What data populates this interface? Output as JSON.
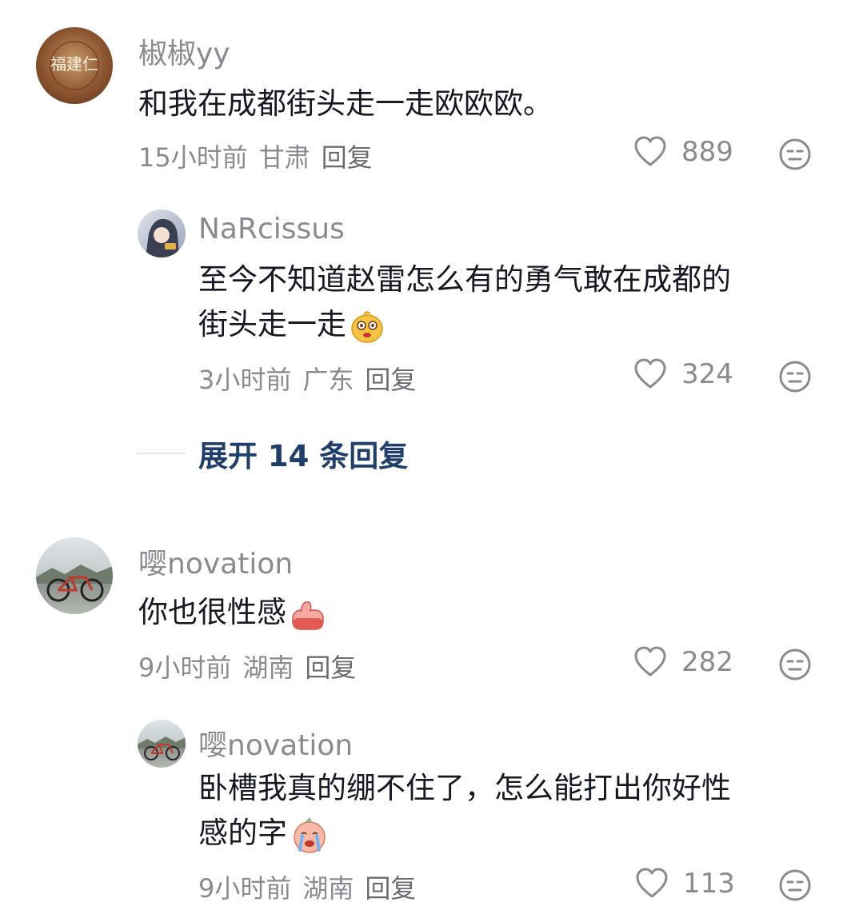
{
  "comments": [
    {
      "username": "椒椒yy",
      "text": "和我在成都街头走一走欧欧欧。",
      "time": "15小时前",
      "location": "甘肃",
      "reply_label": "回复",
      "likes": "889",
      "avatar_text": "福建仁"
    },
    {
      "username": "NaRcissus",
      "text_line1": "至今不知道赵雷怎么有的勇气敢在成都的",
      "text_line2": "街头走一走",
      "time": "3小时前",
      "location": "广东",
      "reply_label": "回复",
      "likes": "324"
    },
    {
      "username": "嘤novation",
      "text": "你也很性感",
      "time": "9小时前",
      "location": "湖南",
      "reply_label": "回复",
      "likes": "282"
    },
    {
      "username": "嘤novation",
      "text_line1": "卧槽我真的绷不住了，怎么能打出你好性",
      "text_line2": "感的字",
      "time": "9小时前",
      "location": "湖南",
      "reply_label": "回复",
      "likes": "113"
    }
  ],
  "expand": {
    "label": "展开 14 条回复"
  },
  "icons": {
    "like": "heart-outline-icon",
    "dislike": "neutral-face-icon"
  },
  "colors": {
    "text": "#161823",
    "meta": "#8a8b91",
    "expand": "#1f3f6a"
  }
}
